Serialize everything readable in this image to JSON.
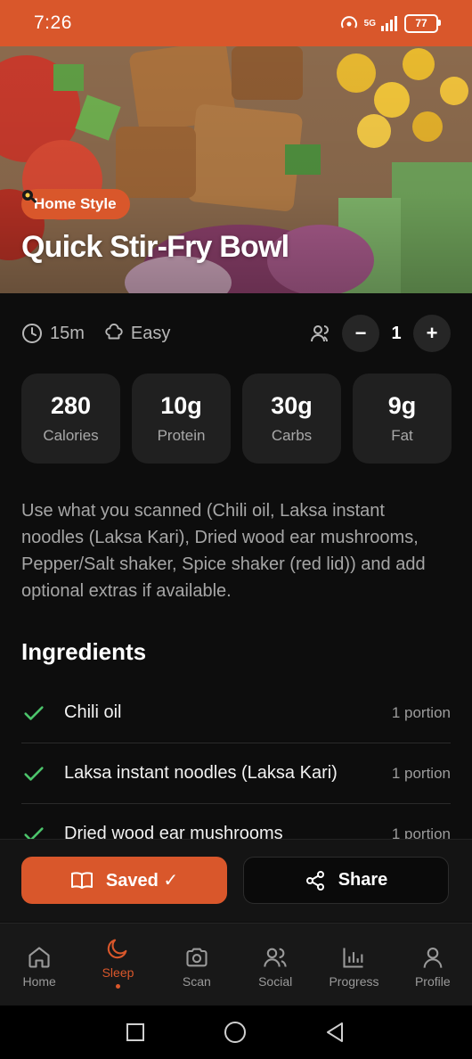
{
  "status_bar": {
    "time": "7:26",
    "network": "5G",
    "battery": "77"
  },
  "hero": {
    "tag_icon": "frying-pan-icon",
    "tag": "Home Style",
    "title": "Quick Stir-Fry Bowl"
  },
  "meta": {
    "time": "15m",
    "difficulty": "Easy",
    "servings": "1",
    "minus": "−",
    "plus": "+"
  },
  "nutrition": [
    {
      "value": "280",
      "label": "Calories"
    },
    {
      "value": "10g",
      "label": "Protein"
    },
    {
      "value": "30g",
      "label": "Carbs"
    },
    {
      "value": "9g",
      "label": "Fat"
    }
  ],
  "description": "Use what you scanned (Chili oil, Laksa instant noodles (Laksa Kari), Dried wood ear mushrooms, Pepper/Salt shaker, Spice shaker (red lid)) and add optional extras if available.",
  "ingredients": {
    "title": "Ingredients",
    "items": [
      {
        "name": "Chili oil",
        "qty": "1 portion"
      },
      {
        "name": "Laksa instant noodles (Laksa Kari)",
        "qty": "1 portion"
      },
      {
        "name": "Dried wood ear mushrooms",
        "qty": "1 portion"
      }
    ]
  },
  "actions": {
    "saved": "Saved ✓",
    "share": "Share"
  },
  "bottom_nav": [
    {
      "label": "Home",
      "icon": "home-icon",
      "active": false
    },
    {
      "label": "Sleep",
      "icon": "moon-icon",
      "active": true
    },
    {
      "label": "Scan",
      "icon": "camera-icon",
      "active": false
    },
    {
      "label": "Social",
      "icon": "users-icon",
      "active": false
    },
    {
      "label": "Progress",
      "icon": "bar-chart-icon",
      "active": false
    },
    {
      "label": "Profile",
      "icon": "user-icon",
      "active": false
    }
  ],
  "colors": {
    "accent": "#d9572b",
    "background": "#0d0d0d",
    "card": "#202020",
    "check": "#4cc46b"
  }
}
